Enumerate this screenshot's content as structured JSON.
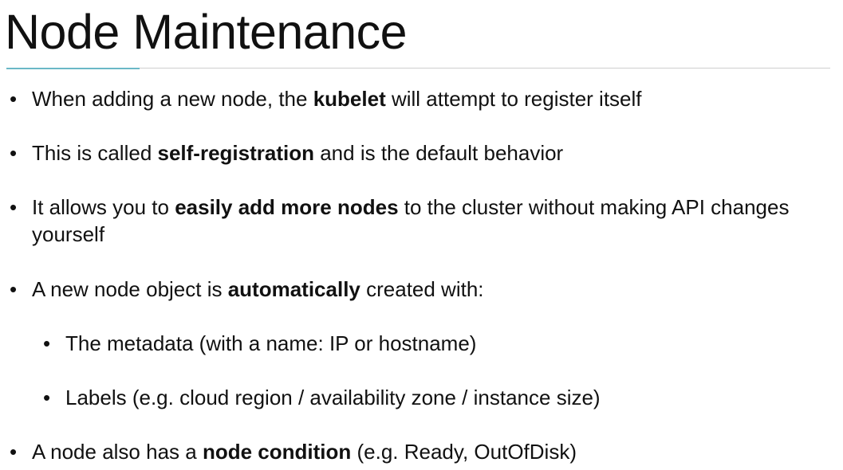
{
  "slide": {
    "title": "Node Maintenance",
    "accent_color": "#6bb8c7",
    "bullets": [
      {
        "level": 1,
        "before": "When adding a new node, the ",
        "bold": "kubelet",
        "after": " will attempt to register itself"
      },
      {
        "level": 1,
        "before": "This is called ",
        "bold": "self-registration",
        "after": " and is the default behavior"
      },
      {
        "level": 1,
        "before": "It allows you to ",
        "bold": "easily add more nodes",
        "after": " to the cluster without making API changes yourself"
      },
      {
        "level": 1,
        "before": "A new node object is ",
        "bold": "automatically",
        "after": " created with:"
      },
      {
        "level": 2,
        "before": "The metadata (with a name: IP or hostname)",
        "bold": "",
        "after": ""
      },
      {
        "level": 2,
        "before": "Labels (e.g. cloud region / availability zone / instance size)",
        "bold": "",
        "after": ""
      },
      {
        "level": 1,
        "before": "A node also has a ",
        "bold": "node condition",
        "after": " (e.g. Ready, OutOfDisk)"
      }
    ]
  }
}
